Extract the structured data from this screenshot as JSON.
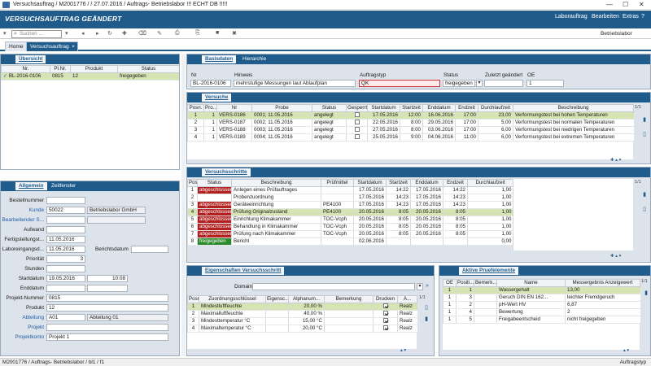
{
  "window_title": "Versuchsauftrag / M2001776 /  / 27.07.2016 / Auftrags- Betriebslabor !!! ECHT DB !!!!!",
  "window_controls": {
    "minimize": "—",
    "maximize": "☐",
    "close": "✕"
  },
  "header": {
    "title": "VERSUCHSAUFTRAG GEÄNDERT",
    "menu": [
      "Laborauftrag",
      "Bearbeiten",
      "Extras",
      "?"
    ]
  },
  "toolbar": {
    "search_placeholder": "Suchen ...",
    "location": "Betriebslabor"
  },
  "tabs": {
    "home": "Home",
    "doc": "Versuchsauftrag",
    "close": "×"
  },
  "overview": {
    "tab": "Übersicht",
    "columns": [
      "Nr.",
      "Pl.Nr.",
      "Produkt",
      "Status"
    ],
    "rows": [
      [
        "BL-2016-0106",
        "0815",
        "12",
        "freigegeben"
      ]
    ],
    "row_mark": "✓"
  },
  "general": {
    "tabs": [
      "Allgemein",
      "Zeitfenster"
    ],
    "labels": {
      "bestellnummer": "Bestellnummer",
      "kunde": "Kunde",
      "bearbeitender": "Bearbeitender S...",
      "aufwand": "Aufwand",
      "fertigstellung": "Fertigstellungst...",
      "laboreingang": "Laboreingangsd...",
      "berichtsdatum": "Berichtsdatum",
      "prioritaet": "Priorität",
      "stunden": "Stunden",
      "startdatum": "Startdatum",
      "enddatum": "Enddatum",
      "projektnr": "Projekt-Nummer",
      "produkt": "Produkt",
      "abteilung": "Abteilung",
      "projekt": "Projekt",
      "projektkonto": "Projektkonto"
    },
    "values": {
      "kunde_nr": "50022",
      "kunde_name": "Betriebslabor GmbH",
      "fertigstellung": "11.05.2016",
      "laboreingang": "11.05.2016",
      "prioritaet": "3",
      "startdatum": "19.05.2016",
      "startzeit": "10:08",
      "projektnr": "0815",
      "produkt": "12",
      "abteilung_nr": "A01",
      "abteilung_name": "Abteilung 01",
      "projektkonto": "Projekt 1"
    }
  },
  "basis": {
    "tabs": [
      "Basisdaten",
      "Hierarchie"
    ],
    "labels": {
      "nr": "Nr",
      "hinweis": "Hinweis",
      "auftragstyp": "Auftragstyp",
      "status": "Status",
      "zuletzt": "Zuletzt geändert",
      "oe": "OE"
    },
    "values": {
      "nr": "BL-2016-0106",
      "hinweis": "mehrstufige Messungen laut Ablaufplan",
      "auftragstyp": "QK",
      "status": "freigegeben",
      "oe": "1"
    }
  },
  "versuche": {
    "tab": "Versuche",
    "columns": [
      "Posn.",
      "Pro...",
      "Nr",
      "Probe",
      "Status",
      "Gesperrt",
      "Startdatum",
      "Startzeit",
      "Enddatum",
      "Endzeit",
      "Durchlaufzeit",
      "Beschreibung"
    ],
    "rows": [
      [
        "1",
        "1",
        "VERS-0186",
        "0001; 11.05.2016",
        "angelegt",
        false,
        "17.05.2016",
        "12:00",
        "16.06.2016",
        "17:00",
        "23,00",
        "Verformungstest bei hohen Temperaturen"
      ],
      [
        "2",
        "1",
        "VERS-0187",
        "0002; 11.05.2016",
        "angelegt",
        false,
        "22.05.2016",
        "8:00",
        "29.05.2016",
        "17:00",
        "5,00",
        "Verformungstest bei normalen Temperaturen"
      ],
      [
        "3",
        "1",
        "VERS-0188",
        "0003; 11.05.2016",
        "angelegt",
        false,
        "27.05.2016",
        "8:00",
        "03.06.2016",
        "17:00",
        "6,00",
        "Verformungstest bei niedrigen Temperaturen"
      ],
      [
        "4",
        "1",
        "VERS-0189",
        "0004; 11.05.2016",
        "angelegt",
        false,
        "25.05.2016",
        "9:00",
        "04.06.2016",
        "11:00",
        "6,00",
        "Verformungstest bei extremen Temperaturen"
      ]
    ],
    "page": "1/1"
  },
  "schritte": {
    "tab": "Versuchsschritte",
    "columns": [
      "Posn.",
      "Status",
      "Beschreibung",
      "Prüfmittel",
      "Startdatum",
      "Startzeit",
      "Enddatum",
      "Endzeit",
      "Durchlaufzeit"
    ],
    "rows": [
      [
        "1",
        "abgeschlossen",
        "Anlegen eines Prüfauftrages",
        "",
        "17.05.2016",
        "14:22",
        "17.05.2016",
        "14:22",
        "1,00"
      ],
      [
        "2",
        "",
        "Probenzuordnung",
        "",
        "17.05.2016",
        "14:23",
        "17.05.2016",
        "14:23",
        "1,00"
      ],
      [
        "3",
        "abgeschlossen",
        "Geräteeinrichtung",
        "PE4100",
        "17.05.2016",
        "14:23",
        "17.05.2016",
        "14:23",
        "1,00"
      ],
      [
        "4",
        "abgeschlossen",
        "Prüfung Originalzustand",
        "PE4100",
        "20.05.2016",
        "8:05",
        "20.05.2016",
        "8:05",
        "1,00"
      ],
      [
        "5",
        "abgeschlossen",
        "Einrichtung Klimakammer",
        "TOC-Vcph",
        "20.05.2016",
        "8:05",
        "20.05.2016",
        "8:05",
        "1,00"
      ],
      [
        "6",
        "abgeschlossen",
        "Behandlung in Klimakammer",
        "TOC-Vcph",
        "20.05.2016",
        "8:05",
        "20.05.2016",
        "8:05",
        "1,00"
      ],
      [
        "7",
        "abgeschlossen",
        "Prüfung nach Klimakammer",
        "TOC-Vcph",
        "20.05.2016",
        "8:05",
        "20.05.2016",
        "8:05",
        "1,00"
      ],
      [
        "8",
        "freigegeben",
        "Bericht",
        "",
        "02.06.2016",
        "",
        "",
        "",
        "0,00"
      ]
    ],
    "page": "1/1"
  },
  "eigenschaften": {
    "tab": "Eigenschaften Versuchsschritt",
    "domain_label": "Domain",
    "columns": [
      "Posn.",
      "Zuordnungsschlüssel",
      "Eigensc...",
      "Alphanum...",
      "Bemerkung",
      "Drucken",
      "Ä..."
    ],
    "rows": [
      [
        "1",
        "Mindestluftfeuchte",
        "",
        "20,00 %",
        "",
        true,
        "Realz"
      ],
      [
        "2",
        "Maximalluftfeuchte",
        "",
        "40,00 %",
        "",
        true,
        "Realz"
      ],
      [
        "3",
        "Mindesttemperatur °C",
        "",
        "15,00 °C",
        "",
        true,
        "Realz"
      ],
      [
        "4",
        "Maximaltemperatur °C",
        "",
        "20,00 °C",
        "",
        true,
        "Realz"
      ]
    ],
    "page": "1/1"
  },
  "pruefelemente": {
    "tab": "Aktive Pruefelemente",
    "columns": [
      "OE",
      "Positi...",
      "Bemerk...",
      "Name",
      "Messergebnis Anzeigewert"
    ],
    "rows": [
      [
        "1",
        "1",
        "",
        "Wassergehalt",
        "13,00"
      ],
      [
        "1",
        "3",
        "",
        "Geruch DIN EN 162...",
        "leichter Fremdgeruch"
      ],
      [
        "1",
        "2",
        "",
        "pH-Wert HV",
        "6,87"
      ],
      [
        "1",
        "4",
        "",
        "Bewertung",
        "2"
      ],
      [
        "1",
        "5",
        "",
        "Freigabeentscheid",
        "nicht freigegeben"
      ]
    ],
    "page": "1/1"
  },
  "statusbar": {
    "left": "M2001776 / Auftrags- Betriebslabor / bl1 / f1",
    "right": "Auftragstyp"
  }
}
